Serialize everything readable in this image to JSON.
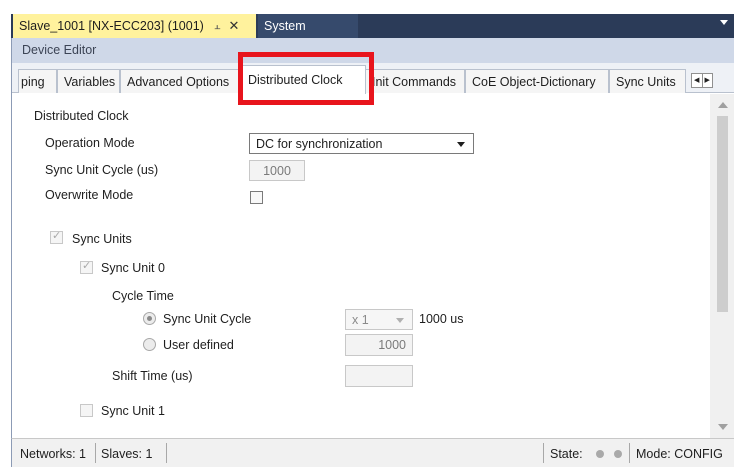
{
  "doc_tabs": {
    "active_label": "Slave_1001 [NX-ECC203] (1001)",
    "pin_icon": "pin-icon",
    "close_icon": "close-icon",
    "inactive_label": "System"
  },
  "editor": {
    "title": "Device Editor",
    "tabs": [
      {
        "label": "ping"
      },
      {
        "label": "Variables"
      },
      {
        "label": "Advanced Options"
      },
      {
        "label": "Distributed Clock",
        "active": true
      },
      {
        "label": "Init Commands"
      },
      {
        "label": "CoE Object-Dictionary"
      },
      {
        "label": "Sync Units"
      }
    ]
  },
  "form": {
    "section_title": "Distributed Clock",
    "operation_mode_label": "Operation Mode",
    "operation_mode_value": "DC for synchronization",
    "sync_unit_cycle_label": "Sync Unit Cycle (us)",
    "sync_unit_cycle_value": "1000",
    "overwrite_mode_label": "Overwrite Mode",
    "sync_units_label": "Sync Units",
    "sync_unit0_label": "Sync Unit 0",
    "cycle_time_label": "Cycle Time",
    "radio_sync_unit_cycle_label": "Sync Unit Cycle",
    "multiplier_value": "x 1",
    "multiplier_result": "1000 us",
    "radio_user_defined_label": "User defined",
    "user_defined_value": "1000",
    "shift_time_label": "Shift Time (us)",
    "shift_time_value": "",
    "sync_unit1_label": "Sync Unit 1"
  },
  "statusbar": {
    "networks": "Networks: 1",
    "slaves": "Slaves: 1",
    "state_label": "State:",
    "mode": "Mode: CONFIG"
  },
  "colors": {
    "doc_tab_active": "#fff29d",
    "doc_strip": "#2b3b58",
    "editor_title_bg": "#cfd8e8",
    "highlight": "#e8141c"
  }
}
